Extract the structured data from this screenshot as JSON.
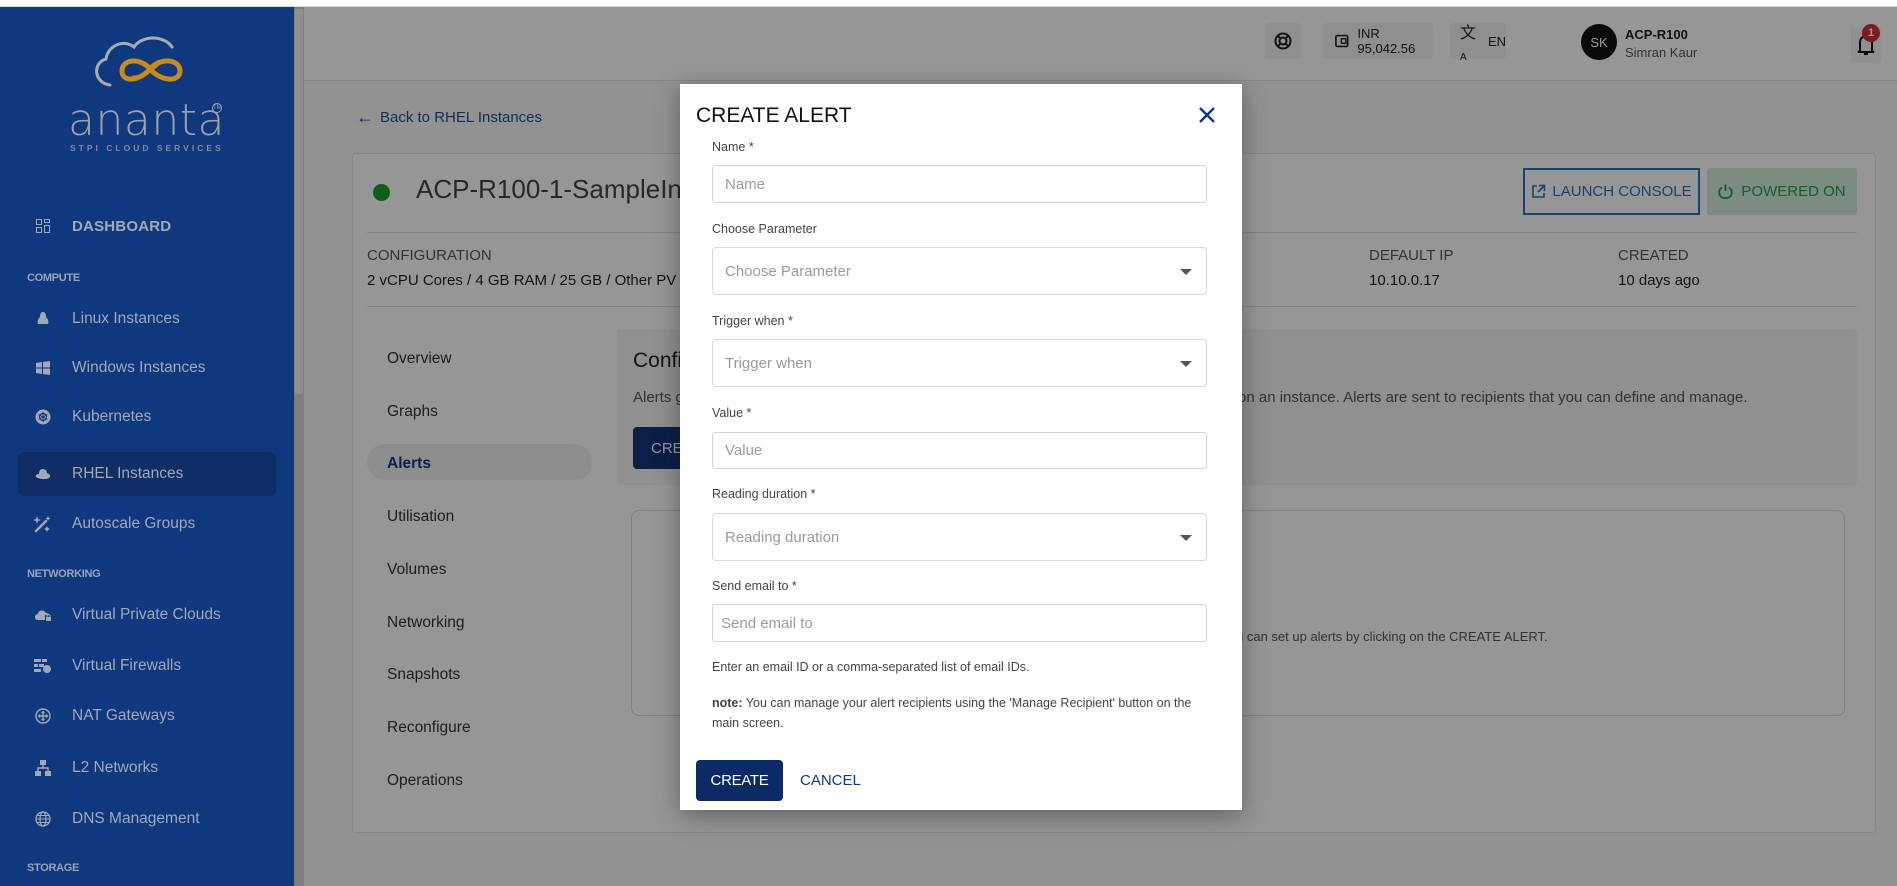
{
  "brand": {
    "name": "ananta",
    "tagline": "STPI CLOUD SERVICES",
    "tm": "TM",
    "colors": {
      "sidebar": "#10387f",
      "logo_orange": "#c98a1c",
      "primary": "#0c2a66",
      "success": "#1e9e4f"
    }
  },
  "sidebar": {
    "dashboard": "DASHBOARD",
    "sections": [
      {
        "title": "COMPUTE",
        "items": [
          {
            "label": "Linux Instances",
            "icon": "linux-icon"
          },
          {
            "label": "Windows Instances",
            "icon": "windows-icon"
          },
          {
            "label": "Kubernetes",
            "icon": "kubernetes-icon"
          },
          {
            "label": "RHEL Instances",
            "icon": "redhat-icon",
            "active": true
          },
          {
            "label": "Autoscale Groups",
            "icon": "magic-wand-icon"
          }
        ]
      },
      {
        "title": "NETWORKING",
        "items": [
          {
            "label": "Virtual Private Clouds",
            "icon": "cloud-lock-icon"
          },
          {
            "label": "Virtual Firewalls",
            "icon": "firewall-icon"
          },
          {
            "label": "NAT Gateways",
            "icon": "nat-gateway-icon"
          },
          {
            "label": "L2 Networks",
            "icon": "network-icon"
          },
          {
            "label": "DNS Management",
            "icon": "globe-icon"
          }
        ]
      },
      {
        "title": "STORAGE",
        "items": []
      }
    ]
  },
  "header": {
    "balance": "INR 95,042.56",
    "language": "EN",
    "user": {
      "initials": "SK",
      "account": "ACP-R100",
      "name": "Simran Kaur"
    },
    "notifications_count": "1"
  },
  "page": {
    "back_link": "Back to RHEL Instances",
    "instance_name": "ACP-R100-1-SampleIns",
    "launch_console": "LAUNCH CONSOLE",
    "power_status": "POWERED ON",
    "meta": [
      {
        "label": "CONFIGURATION",
        "value": "2 vCPU Cores / 4 GB RAM / 25 GB / Other PV V"
      },
      {
        "label": "DEFAULT IP",
        "value": "10.10.0.17"
      },
      {
        "label": "CREATED",
        "value": "10 days ago"
      }
    ],
    "subnav": [
      "Overview",
      "Graphs",
      "Alerts",
      "Utilisation",
      "Volumes",
      "Networking",
      "Snapshots",
      "Reconfigure",
      "Operations"
    ],
    "active_subnav": "Alerts",
    "config_title": "Confi",
    "config_desc_left": "Alerts g",
    "config_desc_right": "on an instance. Alerts are sent to recipients that you can define and manage.",
    "config_create_btn": "CREA",
    "empty_msg": "u can set up alerts by clicking on the CREATE ALERT."
  },
  "modal": {
    "title": "CREATE ALERT",
    "fields": {
      "name": {
        "label": "Name *",
        "placeholder": "Name",
        "value": ""
      },
      "parameter": {
        "label": "Choose Parameter",
        "placeholder": "Choose Parameter"
      },
      "trigger": {
        "label": "Trigger when *",
        "placeholder": "Trigger when"
      },
      "value": {
        "label": "Value *",
        "placeholder": "Value",
        "value": ""
      },
      "duration": {
        "label": "Reading duration *",
        "placeholder": "Reading duration"
      },
      "email": {
        "label": "Send email to *",
        "placeholder": "Send email to",
        "value": ""
      }
    },
    "email_help": "Enter an email ID or a comma-separated list of email IDs.",
    "note_label": "note:",
    "note_text": " You can manage your alert recipients using the 'Manage Recipient' button on the main screen.",
    "create_btn": "CREATE",
    "cancel_btn": "CANCEL"
  }
}
